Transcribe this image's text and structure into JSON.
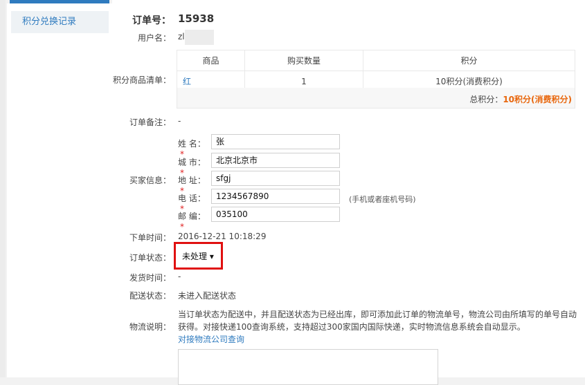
{
  "sidebar": {
    "item": "积分兑换记录"
  },
  "order": {
    "no_label": "订单号：",
    "no": "15938",
    "user_label": "用户名：",
    "user": "zl",
    "goods_label": "积分商品清单：",
    "columns": [
      "商品",
      "购买数量",
      "积分"
    ],
    "row": [
      "红",
      "1",
      "10积分(消费积分)"
    ],
    "total_label": "总积分：",
    "total_value": "10积分(消费积分)",
    "remark_label": "订单备注：",
    "remark": "-",
    "buyer_label": "买家信息："
  },
  "buyer": {
    "name_label": "姓 名：",
    "name": "张",
    "city_label": "城 市：",
    "city": "北京北京市",
    "addr_label": "地 址：",
    "addr": "sfgj",
    "phone_label": "电 话：",
    "phone": "1234567890",
    "phone_hint": "(手机或者座机号码)",
    "zip_label": "邮 编：",
    "zip": "035100"
  },
  "status": {
    "time_label": "下单时间：",
    "time": "2016-12-21 10:18:29",
    "order_status_label": "订单状态：",
    "order_status": "未处理 ▾",
    "ship_time_label": "发货时间：",
    "ship_time": "-",
    "delivery_label": "配送状态：",
    "delivery": "未进入配送状态",
    "logistics_label": "物流说明：",
    "logistics_note": "当订单状态为配送中，并且配送状态为已经出库，即可添加此订单的物流单号，物流公司由所填写的单号自动获得。对接快递100查询系统，支持超过300家国内国际快递，实时物流信息系统会自动显示。",
    "logistics_link": "对接物流公司查询"
  },
  "colors": {
    "accent": "#2f7bbf",
    "points": "#e8660c",
    "required": "#e02020",
    "highlight": "#e01010"
  }
}
